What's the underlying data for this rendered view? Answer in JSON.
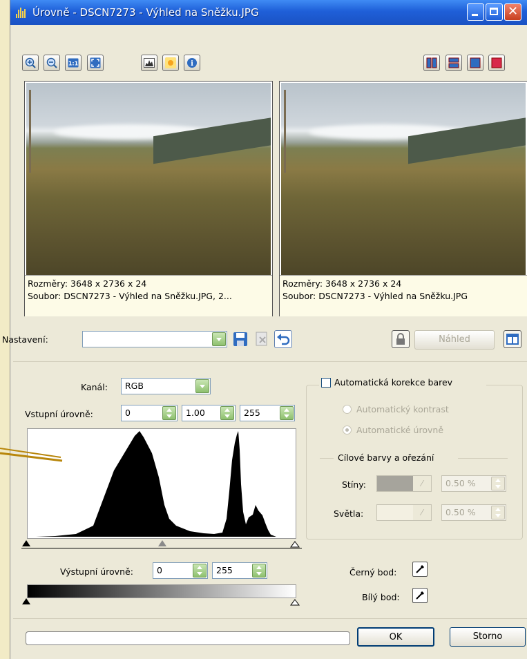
{
  "window": {
    "title": "Úrovně - DSCN7273 - Výhled na Sněžku.JPG",
    "accent": "#1f5fd8",
    "title_controls": [
      "minimize-icon",
      "maximize-icon",
      "close-icon"
    ]
  },
  "toolbar": {
    "left_icons": [
      "zoom-in-icon",
      "zoom-out-icon",
      "actual-size-icon",
      "fit-window-icon",
      "histogram-icon",
      "brightness-icon",
      "info-icon"
    ],
    "right_icons": [
      "split-vertical-icon",
      "split-horizontal-icon",
      "single-view-icon",
      "original-view-icon"
    ]
  },
  "preview": {
    "left": {
      "line1": "Rozměry: 3648 x 2736 x 24",
      "line2": "Soubor: DSCN7273 - Výhled na Sněžku.JPG, 2..."
    },
    "right": {
      "line1": "Rozměry: 3648 x 2736 x 24",
      "line2": "Soubor: DSCN7273 - Výhled na Sněžku.JPG"
    }
  },
  "settings": {
    "label": "Nastavení:",
    "value": "",
    "preview_button": "Náhled"
  },
  "levels": {
    "channel_label": "Kanál:",
    "channel_value": "RGB",
    "input_label": "Vstupní úrovně:",
    "input_black": "0",
    "input_gamma": "1.00",
    "input_white": "255",
    "output_label": "Výstupní úrovně:",
    "output_black": "0",
    "output_white": "255"
  },
  "auto": {
    "checkbox_label": "Automatická korekce barev",
    "checked": false,
    "radio_contrast": "Automatický kontrast",
    "radio_levels": "Automatické úrovně",
    "selected": "Automatické úrovně",
    "target_group": "Cílové barvy a ořezání",
    "shadows_label": "Stíny:",
    "shadows_value": "0.50 %",
    "shadows_color": "#a6a49c",
    "highlights_label": "Světla:",
    "highlights_value": "0.50 %",
    "highlights_color": "#f3f0e2"
  },
  "points": {
    "black_label": "Černý bod:",
    "white_label": "Bílý bod:"
  },
  "buttons": {
    "ok": "OK",
    "cancel": "Storno"
  }
}
